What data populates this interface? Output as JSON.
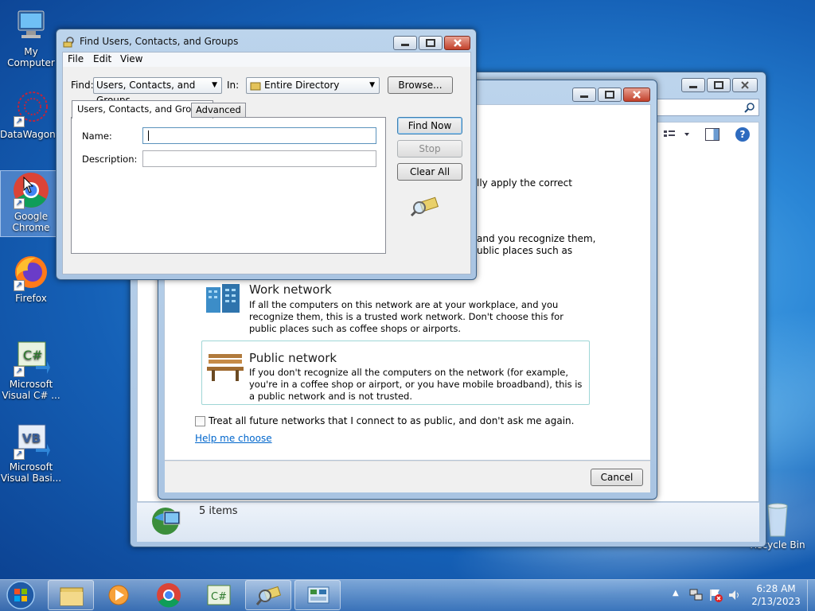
{
  "desktop": {
    "icons": [
      {
        "label": "My Computer"
      },
      {
        "label": "DataWagon..."
      },
      {
        "label": "Google Chrome"
      },
      {
        "label": "Firefox"
      },
      {
        "label": "Microsoft Visual C# ..."
      },
      {
        "label": "Microsoft Visual Basi..."
      },
      {
        "label": "Recycle Bin"
      }
    ]
  },
  "explorer": {
    "status": "5 items"
  },
  "network": {
    "partial_line1": "lly apply the correct",
    "partial_line2": "and you recognize them,",
    "partial_line3": "ublic places such as",
    "work": {
      "title": "Work network",
      "desc": "If all the computers on this network are at your workplace, and you recognize them, this is a trusted work network.  Don't choose this for public places such as coffee shops or airports."
    },
    "public": {
      "title": "Public network",
      "desc": "If you don't recognize all the computers on the network (for example, you're in a coffee shop or airport, or you have mobile broadband), this is a public network and is not trusted."
    },
    "checkbox_label": "Treat all future networks that I connect to as public, and don't ask me again.",
    "help_link": "Help me choose",
    "cancel": "Cancel"
  },
  "find": {
    "title": "Find Users, Contacts, and Groups",
    "menu": [
      "File",
      "Edit",
      "View"
    ],
    "find_label": "Find:",
    "find_value": "Users, Contacts, and Groups",
    "in_label": "In:",
    "in_value": "Entire Directory",
    "browse": "Browse...",
    "tabs": [
      "Users, Contacts, and Groups",
      "Advanced"
    ],
    "name_label": "Name:",
    "name_value": "",
    "desc_label": "Description:",
    "desc_value": "",
    "find_now": "Find Now",
    "stop": "Stop",
    "clear_all": "Clear All"
  },
  "taskbar": {
    "time": "6:28 AM",
    "date": "2/13/2023"
  },
  "colors": {
    "accent": "#3c7fb1",
    "close": "#c2412b",
    "link": "#0066cc"
  }
}
